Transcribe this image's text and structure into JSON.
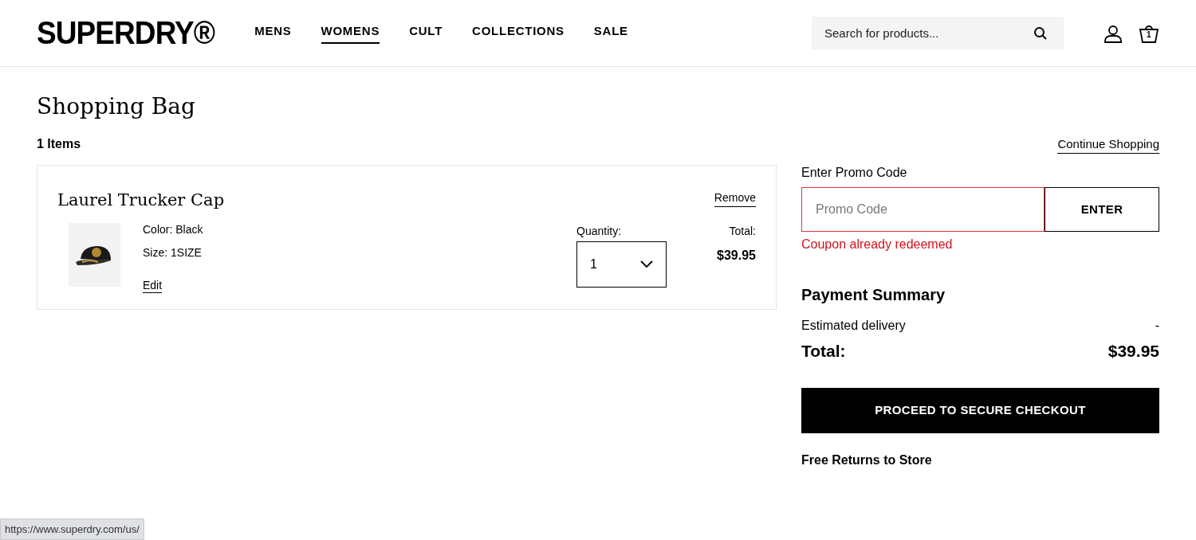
{
  "header": {
    "logo": "SUPERDRY®",
    "nav": [
      {
        "label": "MENS",
        "selected": false
      },
      {
        "label": "WOMENS",
        "selected": true
      },
      {
        "label": "CULT",
        "selected": false
      },
      {
        "label": "COLLECTIONS",
        "selected": false
      },
      {
        "label": "SALE",
        "selected": false
      }
    ],
    "search": {
      "placeholder": "Search for products..."
    },
    "bag_count": "1"
  },
  "page": {
    "title": "Shopping Bag",
    "item_count": "1 Items",
    "continue_link": "Continue Shopping"
  },
  "items": [
    {
      "name": "Laurel Trucker Cap",
      "remove": "Remove",
      "color_text": "Color: Black",
      "size": "Size: 1SIZE",
      "edit": "Edit",
      "quantity_label": "Quantity:",
      "quantity": "1",
      "total_label": "Total:",
      "total": "$39.95"
    }
  ],
  "promo": {
    "label": "Enter Promo Code",
    "placeholder": "Promo Code",
    "button": "ENTER",
    "error": "Coupon already redeemed"
  },
  "summary": {
    "title": "Payment Summary",
    "rows": [
      {
        "label": "Estimated delivery",
        "value": "-",
        "kind": "normal"
      },
      {
        "label": "Total:",
        "value": "$39.95",
        "kind": "total"
      }
    ],
    "checkout": "PROCEED TO SECURE CHECKOUT",
    "returns": "Free Returns to Store"
  },
  "status_bar": "https://www.superdry.com/us/"
}
